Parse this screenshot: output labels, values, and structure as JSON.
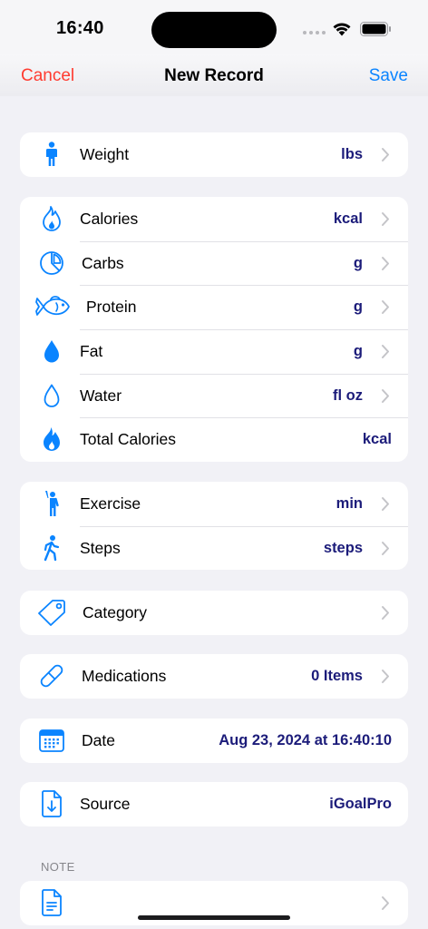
{
  "status_bar": {
    "time": "16:40"
  },
  "nav": {
    "cancel_label": "Cancel",
    "title": "New Record",
    "save_label": "Save"
  },
  "weight_group": [
    {
      "icon": "person-standing-icon",
      "label": "Weight",
      "value": "lbs"
    }
  ],
  "nutrition_group": [
    {
      "icon": "flame-outline-icon",
      "label": "Calories",
      "value": "kcal"
    },
    {
      "icon": "pie-chart-icon",
      "label": "Carbs",
      "value": "g"
    },
    {
      "icon": "fish-icon",
      "label": "Protein",
      "value": "g"
    },
    {
      "icon": "drop-filled-icon",
      "label": "Fat",
      "value": "g"
    },
    {
      "icon": "drop-outline-icon",
      "label": "Water",
      "value": "fl oz"
    },
    {
      "icon": "flame-filled-icon",
      "label": "Total Calories",
      "value": "kcal"
    }
  ],
  "activity_group": [
    {
      "icon": "person-raising-hand-icon",
      "label": "Exercise",
      "value": "min"
    },
    {
      "icon": "person-walking-icon",
      "label": "Steps",
      "value": "steps"
    }
  ],
  "category_row": {
    "icon": "tag-icon",
    "label": "Category",
    "value": ""
  },
  "medications_row": {
    "icon": "pill-icon",
    "label": "Medications",
    "value": "0 Items"
  },
  "date_row": {
    "icon": "calendar-icon",
    "label": "Date",
    "value": "Aug 23, 2024 at 16:40:10"
  },
  "source_row": {
    "icon": "document-download-icon",
    "label": "Source",
    "value": "iGoalPro"
  },
  "note_section": {
    "header": "NOTE",
    "icon": "document-text-icon",
    "value": ""
  },
  "colors": {
    "accent_blue": "#0a84ff",
    "cancel_red": "#ff3b30",
    "value_navy": "#1c1c7a",
    "background": "#f1f1f6"
  }
}
